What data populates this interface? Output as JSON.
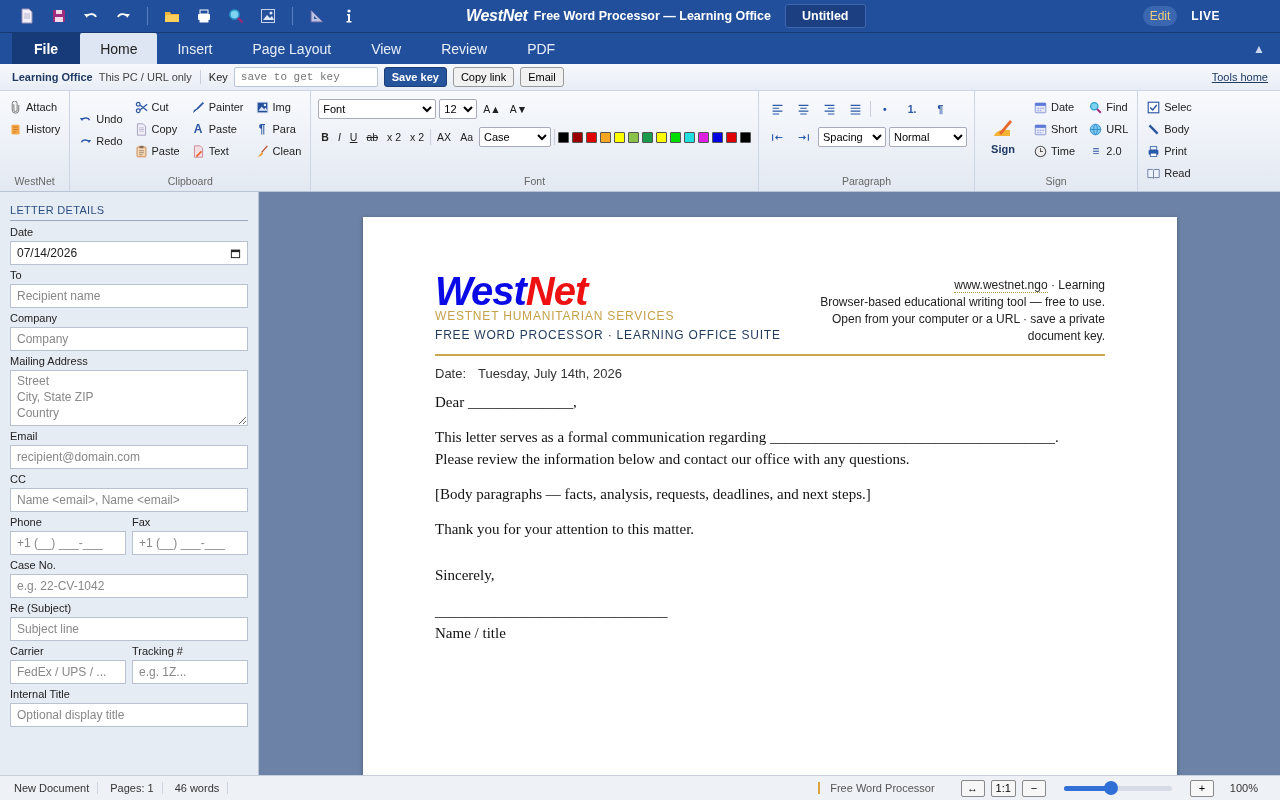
{
  "title": {
    "brand": "WestNet",
    "app": "Free Word Processor — Learning Office",
    "document": "Untitled"
  },
  "mode": "Edit",
  "live": "LIVE",
  "tabs": [
    {
      "label": "File",
      "kind": "file",
      "selected": false
    },
    {
      "label": "Home",
      "kind": "tab",
      "selected": true
    },
    {
      "label": "Insert",
      "kind": "tab",
      "selected": false
    },
    {
      "label": "Page Layout",
      "kind": "tab",
      "selected": false
    },
    {
      "label": "View",
      "kind": "tab",
      "selected": false
    },
    {
      "label": "Review",
      "kind": "tab",
      "selected": false
    },
    {
      "label": "PDF",
      "kind": "tab",
      "selected": false
    }
  ],
  "collapse": "▲",
  "keybar": {
    "brand": "Learning Office",
    "scope": "This PC / URL only",
    "key_label": "Key",
    "key_placeholder": "save to get key",
    "buttons": [
      {
        "label": "Save key",
        "primary": true
      },
      {
        "label": "Copy link",
        "primary": false
      },
      {
        "label": "Email",
        "primary": false
      }
    ],
    "link": "Tools home"
  },
  "ribbon": {
    "westnet": {
      "title": "WestNet",
      "items": [
        {
          "label": "Attach"
        },
        {
          "label": "History"
        }
      ]
    },
    "clipboard": {
      "title": "Clipboard",
      "undo": [
        {
          "label": "Undo"
        },
        {
          "label": "Redo"
        }
      ],
      "columns": [
        [
          {
            "label": "Cut"
          },
          {
            "label": "Copy"
          },
          {
            "label": "Paste"
          }
        ],
        [
          {
            "label": "Painter"
          },
          {
            "label": "Paste",
            "glyph": "A"
          },
          {
            "label": "Text"
          }
        ],
        [
          {
            "label": "Img"
          },
          {
            "label": "Para",
            "glyph": "¶"
          },
          {
            "label": "Clean"
          }
        ]
      ]
    },
    "font": {
      "title": "Font",
      "family": "Font",
      "size": "12",
      "grow": "A▲",
      "shrink": "A▼",
      "styles": [
        {
          "label": "B",
          "kind": "bold"
        },
        {
          "label": "I",
          "kind": "italic"
        },
        {
          "label": "U",
          "kind": "underline"
        },
        {
          "label": "ab",
          "kind": "strike"
        },
        {
          "label": "x 2",
          "kind": "plain"
        },
        {
          "label": "x 2",
          "kind": "plain"
        }
      ],
      "clear": "AX",
      "toggle": "Aa",
      "case": "Case",
      "colors": [
        {
          "color": "#000000"
        },
        {
          "color": "#990000"
        },
        {
          "color": "#e00000"
        },
        {
          "color": "#f5a623"
        },
        {
          "color": "#ffff00"
        },
        {
          "color": "#8bc34a"
        },
        {
          "color": "#1a9a4a"
        },
        {
          "color": "#ffff00"
        },
        {
          "color": "#00dd00"
        },
        {
          "color": "#22e0e0"
        },
        {
          "color": "#e020e0"
        },
        {
          "color": "#0000e0"
        },
        {
          "color": "#e00000"
        },
        {
          "color": "#000000"
        }
      ]
    },
    "paragraph": {
      "title": "Paragraph",
      "marks": [
        "•",
        "1.",
        "¶"
      ],
      "spacing": "Spacing",
      "style": "Normal"
    },
    "sign": {
      "title": "Sign",
      "big": "Sign",
      "columns": [
        [
          {
            "label": "Date"
          },
          {
            "label": "Short"
          },
          {
            "label": "Time"
          }
        ],
        [
          {
            "label": "Find"
          },
          {
            "label": "URL"
          },
          {
            "label": "2.0",
            "glyph": "≡"
          }
        ]
      ]
    },
    "more": {
      "items": [
        {
          "label": "Selec"
        },
        {
          "label": "Body"
        },
        {
          "label": "Print"
        },
        {
          "label": "Read"
        }
      ]
    }
  },
  "sidebar": {
    "heading": "LETTER DETAILS",
    "fields": [
      {
        "kind": "date",
        "label": "Date",
        "value": "07/14/2026"
      },
      {
        "kind": "text",
        "label": "To",
        "placeholder": "Recipient name"
      },
      {
        "kind": "text",
        "label": "Company",
        "placeholder": "Company"
      },
      {
        "kind": "textarea",
        "label": "Mailing Address",
        "placeholder": "Street\nCity, State ZIP\nCountry"
      },
      {
        "kind": "text",
        "label": "Email",
        "placeholder": "recipient@domain.com"
      },
      {
        "kind": "text",
        "label": "CC",
        "placeholder": "Name <email>, Name <email>"
      },
      {
        "kind": "pair",
        "fields": [
          {
            "label": "Phone",
            "placeholder": "+1 (__) ___-___"
          },
          {
            "label": "Fax",
            "placeholder": "+1 (__) ___-___"
          }
        ]
      },
      {
        "kind": "text",
        "label": "Case No.",
        "placeholder": "e.g. 22-CV-1042"
      },
      {
        "kind": "text",
        "label": "Re (Subject)",
        "placeholder": "Subject line"
      },
      {
        "kind": "pair",
        "fields": [
          {
            "label": "Carrier",
            "placeholder": "FedEx / UPS / ..."
          },
          {
            "label": "Tracking #",
            "placeholder": "e.g. 1Z..."
          }
        ]
      },
      {
        "kind": "text",
        "label": "Internal Title",
        "placeholder": "Optional display title"
      }
    ]
  },
  "letter": {
    "logo": [
      {
        "text": "West",
        "color": "#0a0ae6"
      },
      {
        "text": "Net",
        "color": "#ee1111"
      }
    ],
    "org": "WESTNET HUMANITARIAN SERVICES",
    "suite": "FREE WORD PROCESSOR · LEARNING OFFICE SUITE",
    "contact": {
      "link": "www.westnet.ngo",
      "rest": " · Learning",
      "lines": [
        "Browser-based educational writing tool — free to use.",
        "Open from your computer or a URL · save a private document key."
      ]
    },
    "date_label": "Date:",
    "date": "Tuesday, July 14th, 2026",
    "paragraphs": [
      {
        "kind": "para",
        "lines": [
          "Dear ______________,"
        ]
      },
      {
        "kind": "para",
        "lines": [
          "This letter serves as a formal communication regarding ______________________________________.",
          "Please review the information below and contact our office with any questions."
        ]
      },
      {
        "kind": "para",
        "lines": [
          "[Body paragraphs — facts, analysis, requests, deadlines, and next steps.]"
        ]
      },
      {
        "kind": "para",
        "lines": [
          "Thank you for your attention to this matter."
        ]
      },
      {
        "kind": "closing",
        "lines": [
          "Sincerely,"
        ]
      },
      {
        "kind": "signature",
        "lines": [
          "_______________________________",
          "Name / title"
        ]
      }
    ]
  },
  "status": {
    "items": [
      "New Document",
      "Pages: 1",
      "46 words"
    ],
    "app": "Free Word Processor",
    "buttons": [
      "↔",
      "1:1",
      "−"
    ],
    "zoom": {
      "level": 0.44
    },
    "plus": "+",
    "percent": "100%"
  }
}
